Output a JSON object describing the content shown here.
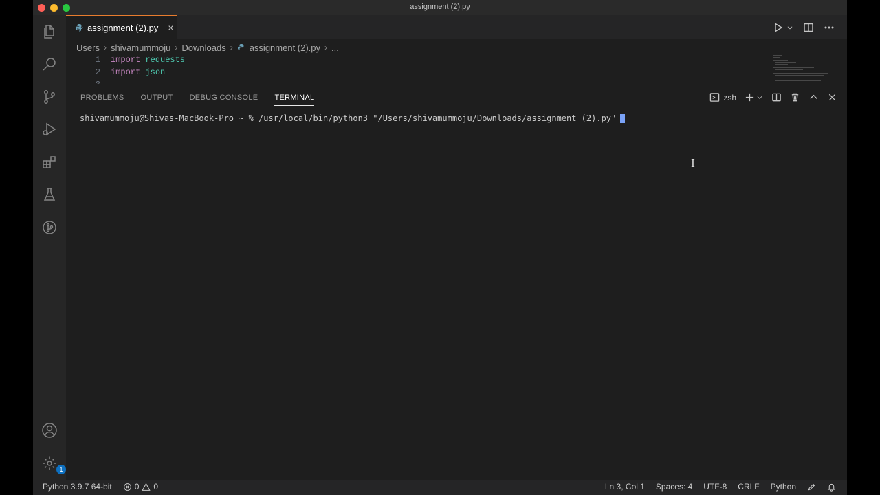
{
  "window": {
    "title": "assignment (2).py"
  },
  "colors": {
    "tab_accent": "#e87c2e",
    "badge": "#0e70c0",
    "keyword": "#c586c0",
    "module": "#4ec9b0"
  },
  "tab": {
    "label": "assignment (2).py",
    "close": "×"
  },
  "breadcrumb": {
    "items": [
      "Users",
      "shivamummoju",
      "Downloads",
      "assignment (2).py",
      "..."
    ]
  },
  "editor": {
    "lines": [
      {
        "num": "1",
        "keyword": "import",
        "module": "requests"
      },
      {
        "num": "2",
        "keyword": "import",
        "module": "json"
      },
      {
        "num": "3"
      }
    ]
  },
  "panel": {
    "tabs": [
      "PROBLEMS",
      "OUTPUT",
      "DEBUG CONSOLE",
      "TERMINAL"
    ],
    "active_tab": "TERMINAL",
    "shell": "zsh",
    "terminal_line": "shivamummoju@Shivas-MacBook-Pro ~ % /usr/local/bin/python3 \"/Users/shivamummoju/Downloads/assignment (2).py\""
  },
  "activity": {
    "badge_count": "1"
  },
  "statusbar": {
    "interpreter": "Python 3.9.7 64-bit",
    "errors": "0",
    "warnings": "0",
    "position": "Ln 3, Col 1",
    "spaces": "Spaces: 4",
    "encoding": "UTF-8",
    "eol": "CRLF",
    "language": "Python"
  },
  "icons": [
    "explorer-icon",
    "search-icon",
    "source-control-icon",
    "run-debug-icon",
    "extensions-icon",
    "testing-icon",
    "git-graph-icon",
    "account-icon",
    "settings-gear-icon",
    "python-file-icon",
    "run-icon",
    "split-editor-icon",
    "more-icon",
    "terminal-icon",
    "add-icon",
    "chevron-down-icon",
    "trash-icon",
    "chevron-up-icon",
    "close-icon",
    "error-icon",
    "warning-icon",
    "feedback-icon",
    "bell-icon"
  ]
}
